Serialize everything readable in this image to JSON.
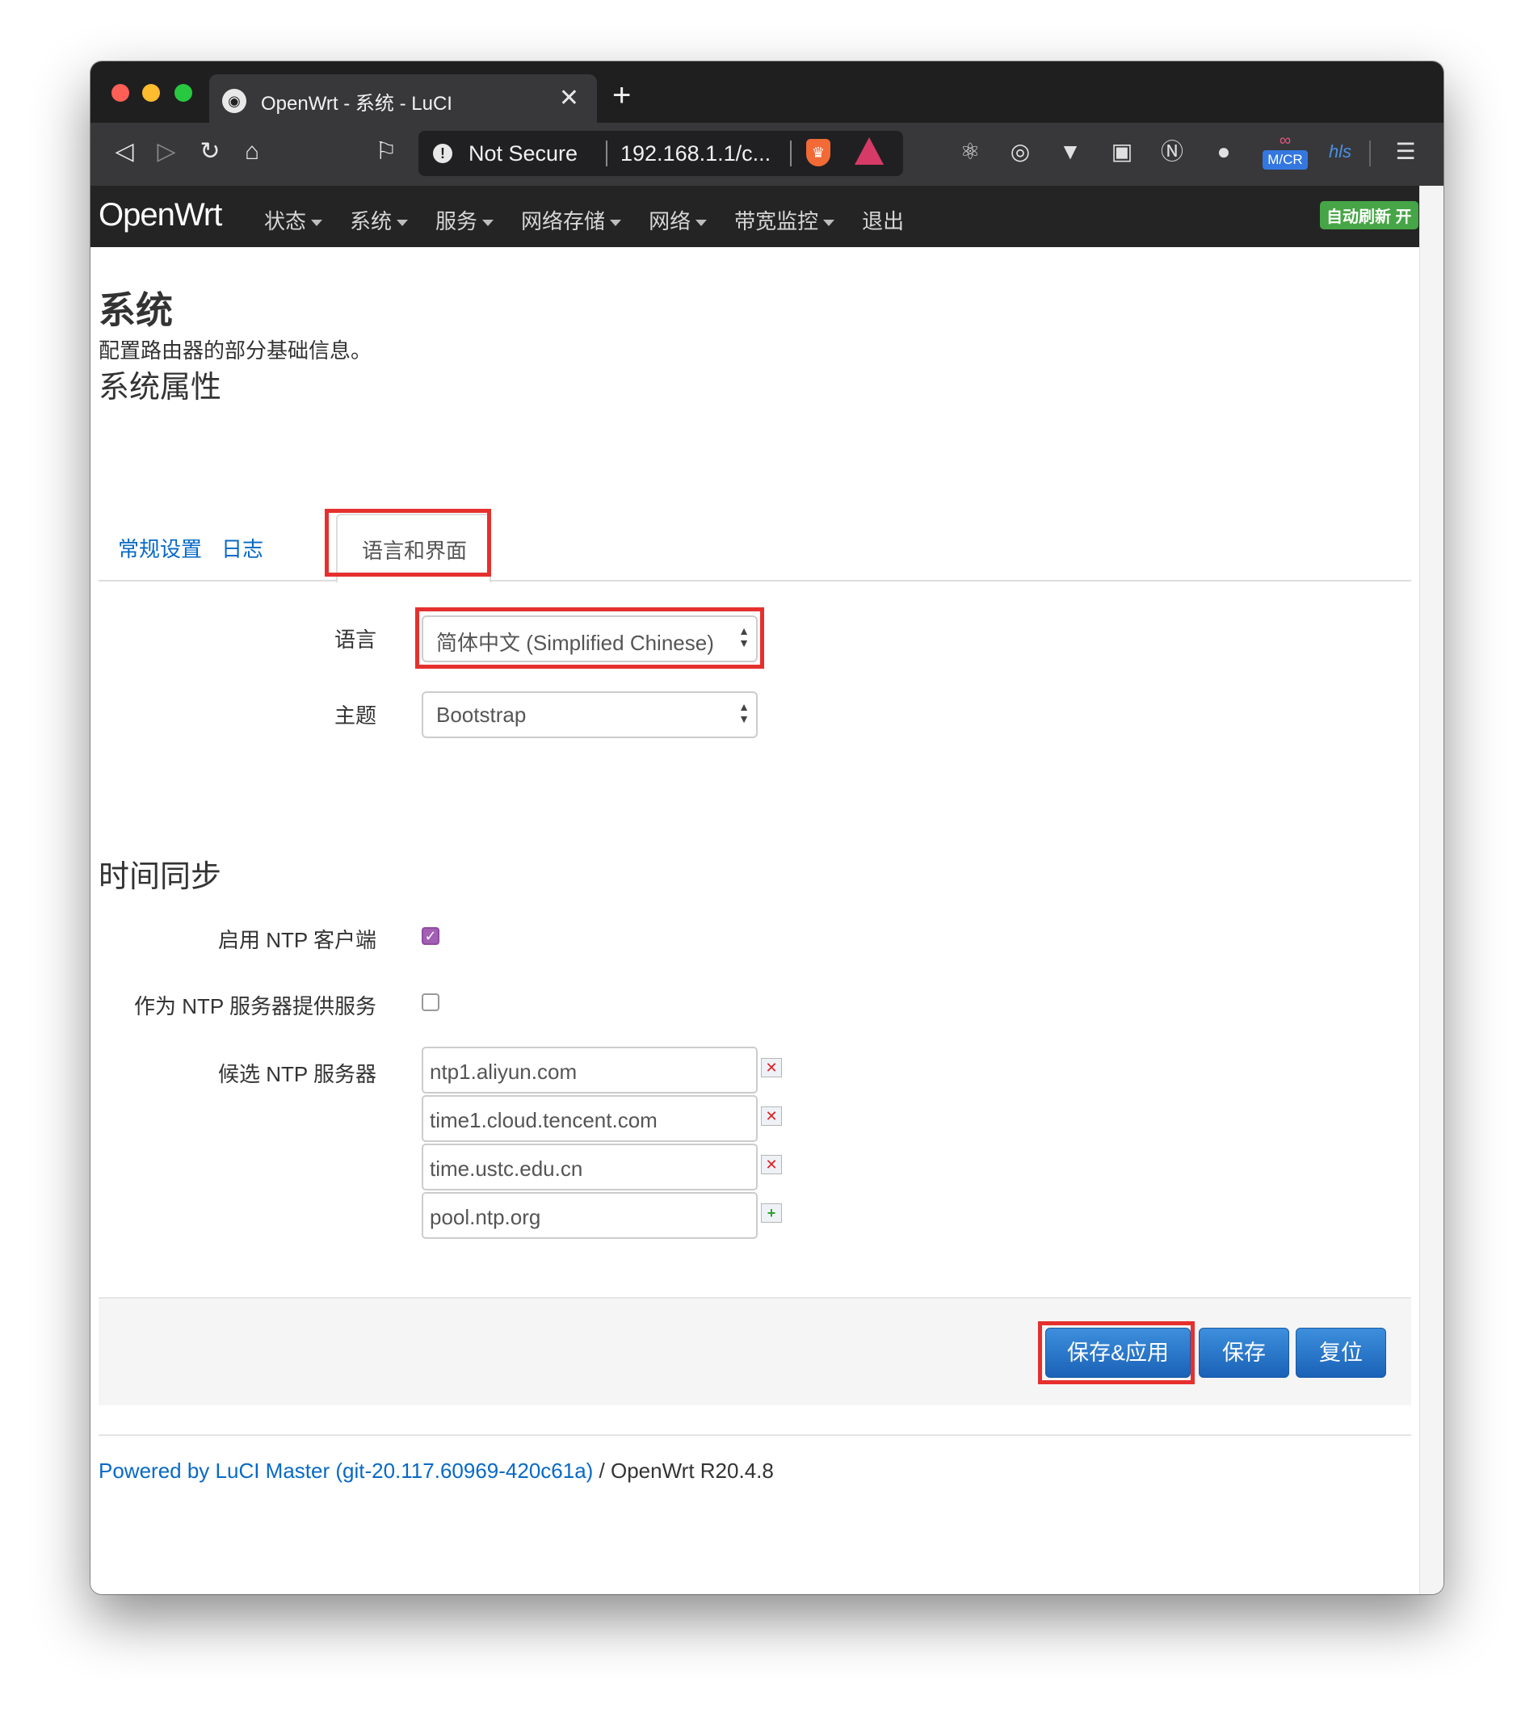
{
  "browser": {
    "tab_title": "OpenWrt - 系统 - LuCI",
    "url_security": "Not Secure",
    "url": "192.168.1.1/c...",
    "extension_label": "M/CR"
  },
  "header": {
    "brand": "OpenWrt",
    "nav": [
      "状态",
      "系统",
      "服务",
      "网络存储",
      "网络",
      "带宽监控",
      "退出"
    ],
    "auto_refresh": "自动刷新 开"
  },
  "page": {
    "title": "系统",
    "description": "配置路由器的部分基础信息。",
    "section_system": "系统属性",
    "tabs": [
      "常规设置",
      "日志",
      "语言和界面"
    ],
    "active_tab": "语言和界面",
    "language_label": "语言",
    "language_value": "简体中文 (Simplified Chinese)",
    "theme_label": "主题",
    "theme_value": "Bootstrap",
    "section_time": "时间同步",
    "ntp_client_label": "启用 NTP 客户端",
    "ntp_client_enabled": true,
    "ntp_server_label": "作为 NTP 服务器提供服务",
    "ntp_server_enabled": false,
    "ntp_candidates_label": "候选 NTP 服务器",
    "ntp_servers": [
      "ntp1.aliyun.com",
      "time1.cloud.tencent.com",
      "time.ustc.edu.cn",
      "pool.ntp.org"
    ]
  },
  "actions": {
    "save_apply": "保存&应用",
    "save": "保存",
    "reset": "复位"
  },
  "footer": {
    "powered_by": "Powered by LuCI Master (git-20.117.60969-420c61a)",
    "separator": " / ",
    "version": "OpenWrt R20.4.8"
  },
  "colors": {
    "highlight": "#e5302e",
    "primary_button": "#1f6ec6",
    "link": "#0769c6",
    "auto_refresh": "#46a546"
  }
}
